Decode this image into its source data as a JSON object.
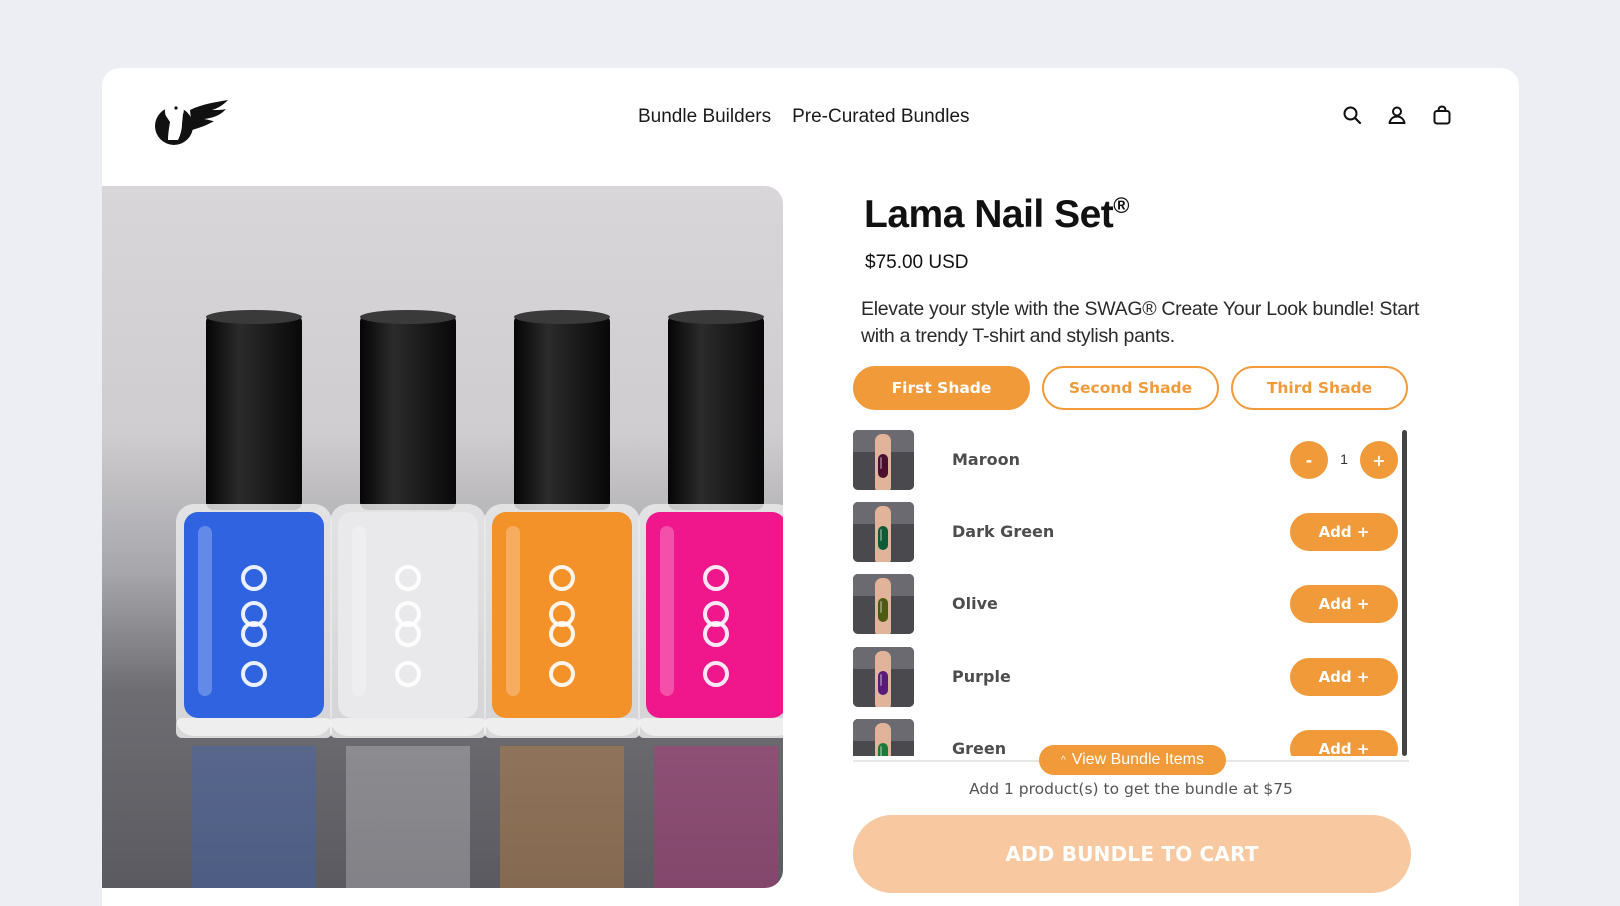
{
  "header": {
    "logo_icon": "llama-wing-logo",
    "nav": [
      "Bundle Builders",
      "Pre-Curated Bundles"
    ],
    "icons": [
      "search-icon",
      "user-icon",
      "cart-icon"
    ]
  },
  "product": {
    "title": "Lama Nail Set",
    "trademark": "®",
    "price": "$75.00 USD",
    "description": "Elevate your style with the SWAG® Create Your Look bundle! Start with a trendy T-shirt and stylish pants.",
    "image_bottle_colors": [
      "#2f63e0",
      "#e9e9ec",
      "#f4922a",
      "#f0168c"
    ]
  },
  "tabs": [
    {
      "label": "First Shade",
      "active": true
    },
    {
      "label": "Second Shade",
      "active": false
    },
    {
      "label": "Third Shade",
      "active": false
    }
  ],
  "items": [
    {
      "name": "Maroon",
      "color": "#4a0f2e",
      "in_bundle": true,
      "qty": "1",
      "minus": "-",
      "plus": "+"
    },
    {
      "name": "Dark Green",
      "color": "#0f5a37",
      "in_bundle": false,
      "button": "Add +"
    },
    {
      "name": "Olive",
      "color": "#4d5a12",
      "in_bundle": false,
      "button": "Add +"
    },
    {
      "name": "Purple",
      "color": "#5a1a7a",
      "in_bundle": false,
      "button": "Add +"
    },
    {
      "name": "Green",
      "color": "#1a7a3a",
      "in_bundle": false,
      "button": "Add +"
    }
  ],
  "view_items": {
    "caret": "^",
    "label": "View Bundle Items"
  },
  "note": "Add 1 product(s) to get the bundle at $75",
  "cta": "ADD BUNDLE TO CART",
  "colors": {
    "accent": "#f19a3a",
    "cta_disabled": "#f8c9a0",
    "page_bg": "#eceef3"
  }
}
